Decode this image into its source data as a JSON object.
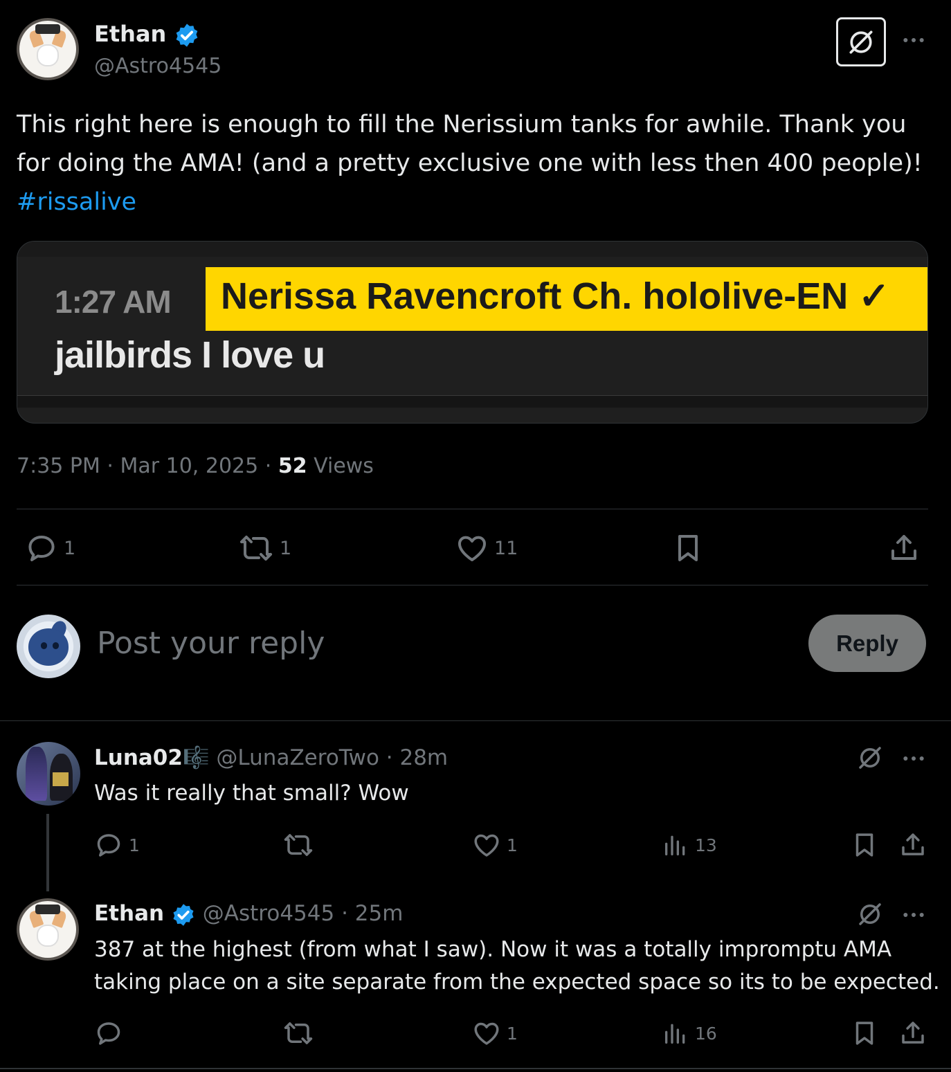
{
  "post": {
    "author_name": "Ethan",
    "author_handle": "@Astro4545",
    "text_line1": "This right here is enough to fill the Nerissium tanks for awhile. Thank you",
    "text_line2": "for doing the AMA! (and a pretty exclusive one with less then 400 people)!",
    "hashtag": "#rissalive",
    "timestamp": "7:35 PM · Mar 10, 2025 · ",
    "views_count": "52",
    "views_label": " Views",
    "replies": "1",
    "reposts": "1",
    "likes": "11",
    "embed": {
      "time": "1:27 AM",
      "channel": "Nerissa Ravencroft Ch. hololive-EN ✓",
      "message": "jailbirds I love u"
    }
  },
  "composer": {
    "placeholder": "Post your reply",
    "button_label": "Reply"
  },
  "replies": [
    {
      "name": "Luna02",
      "badge": "🎼",
      "handle_time": "@LunaZeroTwo · 28m",
      "text": "Was it really that small? Wow",
      "replies": "1",
      "reposts": "",
      "likes": "1",
      "views": "13"
    },
    {
      "name": "Ethan",
      "handle_time": "@Astro4545 · 25m",
      "text_line1": "387 at the highest (from what I saw). Now it was a totally impromptu AMA",
      "text_line2": "taking place on a site separate from the expected space so its to be expected.",
      "replies": "",
      "reposts": "",
      "likes": "1",
      "views": "16"
    }
  ],
  "colors": {
    "background": "#000000",
    "text": "#e7e9ea",
    "muted": "#71767b",
    "link": "#1d9bf0",
    "verified": "#1d9bf0",
    "embed_highlight": "#ffd600"
  },
  "icons": [
    "grok-icon",
    "more-icon",
    "reply-icon",
    "repost-icon",
    "like-icon",
    "bookmark-icon",
    "share-icon",
    "views-icon",
    "verified-icon"
  ]
}
